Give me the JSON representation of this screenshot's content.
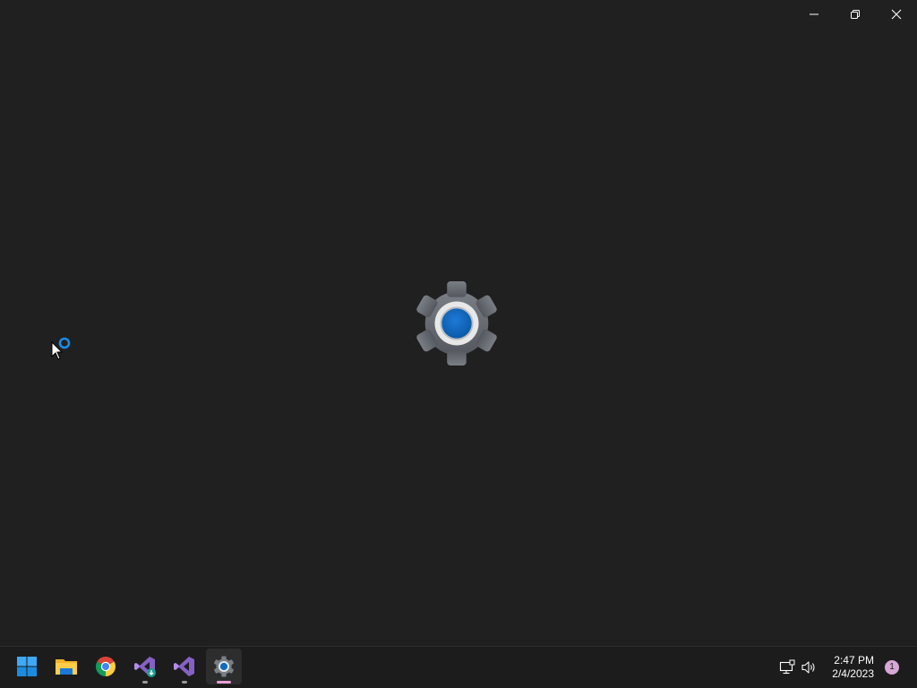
{
  "window": {
    "caption_buttons": [
      {
        "name": "minimize-button",
        "icon": "minimize-icon"
      },
      {
        "name": "restore-button",
        "icon": "restore-icon"
      },
      {
        "name": "close-button",
        "icon": "close-icon"
      }
    ],
    "splash_icon": "settings-gear-icon",
    "accent_color": "#0f6cbd"
  },
  "cursor": {
    "state": "busy",
    "icon": "busy-cursor-icon"
  },
  "taskbar": {
    "apps": [
      {
        "name": "start",
        "icon": "windows-start-icon",
        "state": "none"
      },
      {
        "name": "file-explorer",
        "icon": "folder-icon",
        "state": "none"
      },
      {
        "name": "chrome",
        "icon": "chrome-icon",
        "state": "none"
      },
      {
        "name": "visual-studio-installer",
        "icon": "visual-studio-installer-icon",
        "state": "running"
      },
      {
        "name": "visual-studio",
        "icon": "visual-studio-icon",
        "state": "running"
      },
      {
        "name": "settings",
        "icon": "settings-icon",
        "state": "focused"
      }
    ],
    "tray": {
      "network_icon": "network-icon",
      "volume_icon": "volume-icon",
      "time": "2:47 PM",
      "date": "2/4/2023",
      "notification_count": "1"
    }
  }
}
